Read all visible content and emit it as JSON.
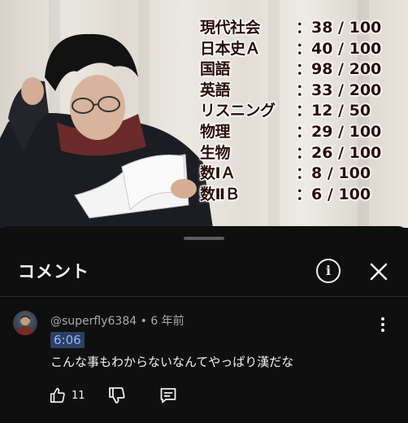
{
  "video": {
    "scores": [
      {
        "subject": "現代社会",
        "value": "：38 / 100"
      },
      {
        "subject": "日本史Ａ",
        "value": "：40 / 100"
      },
      {
        "subject": "国語",
        "value": "：98 / 200"
      },
      {
        "subject": "英語",
        "value": "：33 / 200"
      },
      {
        "subject": "リスニング",
        "value": "：12 / 50"
      },
      {
        "subject": "物理",
        "value": "：29 / 100"
      },
      {
        "subject": "生物",
        "value": "：26 / 100"
      },
      {
        "subject": "数ⅠＡ",
        "value": "：8 / 100"
      },
      {
        "subject": "数ⅡＢ",
        "value": "：6 / 100"
      }
    ]
  },
  "sheet": {
    "title": "コメント",
    "icons": {
      "info": "info-icon",
      "close": "close-icon"
    }
  },
  "comment": {
    "author": "@superfly6384",
    "separator": " • ",
    "age": "6 年前",
    "timestamp": "6:06",
    "text": "こんな事もわからないなんてやっぱり漢だな",
    "like_count": "11",
    "icons": {
      "like": "thumbs-up-icon",
      "dislike": "thumbs-down-icon",
      "reply": "reply-icon",
      "more": "more-vertical-icon"
    }
  },
  "colors": {
    "background": "#0f0f0f",
    "text": "#f1f1f1",
    "secondary": "#aaaaaa",
    "timestamp_bg": "#2d3f63",
    "timestamp_fg": "#8fb6ff"
  }
}
